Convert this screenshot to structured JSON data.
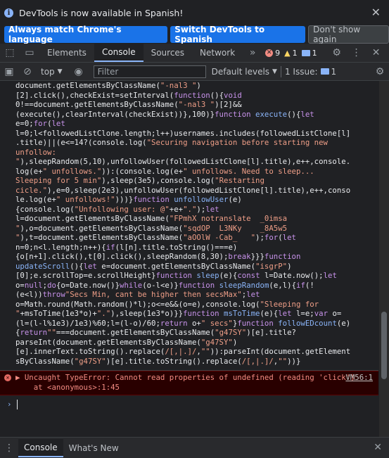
{
  "infobar": {
    "message": "DevTools is now available in Spanish!",
    "btn_match": "Always match Chrome's language",
    "btn_switch": "Switch DevTools to Spanish",
    "btn_dismiss": "Don't show again"
  },
  "tabs": [
    "Elements",
    "Console",
    "Sources",
    "Network"
  ],
  "badges": {
    "errors": "9",
    "warnings": "1",
    "messages": "1"
  },
  "toolbar": {
    "context": "top",
    "filter_placeholder": "Filter",
    "levels": "Default levels",
    "issues": "1 Issue:",
    "issues_count": "1"
  },
  "error": {
    "message": "Uncaught TypeError: Cannot read properties of undefined (reading 'click')",
    "trace": "    at <anonymous>:1:45",
    "source": "VM56:1"
  },
  "drawer": {
    "tab1": "Console",
    "tab2": "What's New"
  },
  "colors": {
    "accent": "#1a73e8",
    "error_bg": "#290000",
    "error_text": "#f28b82"
  }
}
